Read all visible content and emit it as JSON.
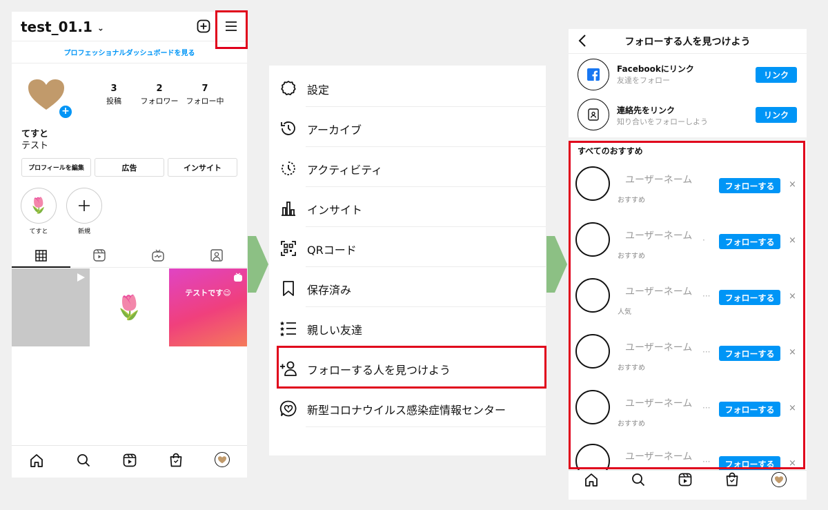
{
  "left": {
    "username": "test_01.1",
    "dashboard_link": "プロフェッショナルダッシュボードを見る",
    "stats": [
      {
        "value": "3",
        "label": "投稿"
      },
      {
        "value": "2",
        "label": "フォロワー"
      },
      {
        "value": "7",
        "label": "フォロー中"
      }
    ],
    "display_name": "てすと",
    "bio": "テスト",
    "buttons": {
      "edit": "プロフィールを編集",
      "ads": "広告",
      "insights": "インサイト"
    },
    "highlights": [
      {
        "label": "てすと"
      },
      {
        "label": "新規"
      }
    ],
    "post_text": "テストです😉",
    "colors": {
      "accent": "#0095f6",
      "highlight_red": "#e0001b"
    }
  },
  "menu": {
    "items": [
      {
        "label": "設定",
        "icon": "gear-icon"
      },
      {
        "label": "アーカイブ",
        "icon": "archive-icon"
      },
      {
        "label": "アクティビティ",
        "icon": "activity-icon"
      },
      {
        "label": "インサイト",
        "icon": "insights-icon"
      },
      {
        "label": "QRコード",
        "icon": "qr-code-icon"
      },
      {
        "label": "保存済み",
        "icon": "bookmark-icon"
      },
      {
        "label": "親しい友達",
        "icon": "close-friends-icon"
      },
      {
        "label": "フォローする人を見つけよう",
        "icon": "add-person-icon"
      },
      {
        "label": "新型コロナウイルス感染症情報センター",
        "icon": "covid-info-icon"
      }
    ]
  },
  "right": {
    "title": "フォローする人を見つけよう",
    "connect": [
      {
        "title": "Facebookにリンク",
        "subtitle": "友達をフォロー",
        "button": "リンク"
      },
      {
        "title": "連絡先をリンク",
        "subtitle": "知り合いをフォローしよう",
        "button": "リンク"
      }
    ],
    "section_title": "すべてのおすすめ",
    "suggestions": [
      {
        "name": "ユーザーネーム",
        "sub": "おすすめ",
        "dots": "",
        "button": "フォローする",
        "dismiss": "×"
      },
      {
        "name": "ユーザーネーム",
        "sub": "おすすめ",
        "dots": "·",
        "button": "フォローする",
        "dismiss": "×"
      },
      {
        "name": "ユーザーネーム",
        "sub": "人気",
        "dots": "···",
        "button": "フォローする",
        "dismiss": "×"
      },
      {
        "name": "ユーザーネーム",
        "sub": "おすすめ",
        "dots": "···",
        "button": "フォローする",
        "dismiss": "×"
      },
      {
        "name": "ユーザーネーム",
        "sub": "おすすめ",
        "dots": "···",
        "button": "フォローする",
        "dismiss": "×"
      },
      {
        "name": "ユーザーネーム",
        "sub": "",
        "dots": "···",
        "button": "フォローする",
        "dismiss": "×"
      }
    ]
  }
}
